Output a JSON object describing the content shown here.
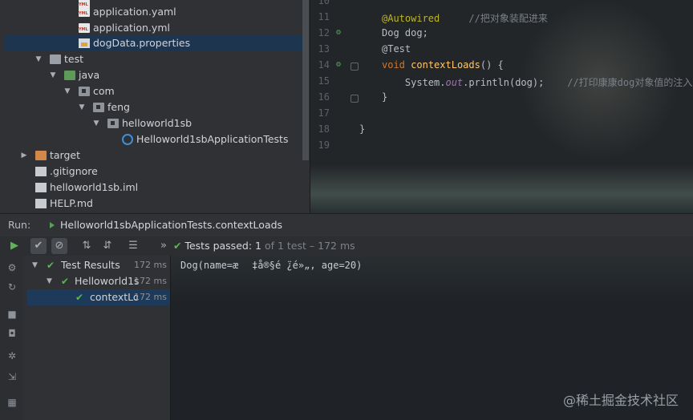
{
  "project_tree": {
    "items": [
      {
        "label": "application.yaml",
        "icon": "yaml-file-icon",
        "depth": 5,
        "arrow": ""
      },
      {
        "label": "application.yml",
        "icon": "yaml-file-icon",
        "depth": 5,
        "arrow": ""
      },
      {
        "label": "dogData.properties",
        "icon": "properties-file-icon",
        "depth": 5,
        "arrow": "",
        "selected": true
      },
      {
        "label": "test",
        "icon": "folder-icon",
        "depth": 2,
        "arrow": "▼"
      },
      {
        "label": "java",
        "icon": "source-folder-icon",
        "depth": 3,
        "arrow": "▼"
      },
      {
        "label": "com",
        "icon": "package-icon",
        "depth": 4,
        "arrow": "▼"
      },
      {
        "label": "feng",
        "icon": "package-icon",
        "depth": 5,
        "arrow": "▼"
      },
      {
        "label": "helloworld1sb",
        "icon": "package-icon",
        "depth": 6,
        "arrow": "▼"
      },
      {
        "label": "Helloworld1sbApplicationTests",
        "icon": "class-icon",
        "depth": 7,
        "arrow": ""
      },
      {
        "label": "target",
        "icon": "target-folder-icon",
        "depth": 1,
        "arrow": "▶"
      },
      {
        "label": ".gitignore",
        "icon": "gitignore-file-icon",
        "depth": 1,
        "arrow": ""
      },
      {
        "label": "helloworld1sb.iml",
        "icon": "iml-file-icon",
        "depth": 1,
        "arrow": ""
      },
      {
        "label": "HELP.md",
        "icon": "markdown-file-icon",
        "depth": 1,
        "arrow": ""
      }
    ]
  },
  "editor": {
    "lines": [
      {
        "num": "10",
        "code": ""
      },
      {
        "num": "11",
        "code": "@Autowired     //把对象装配进来"
      },
      {
        "num": "12",
        "code": "Dog dog;"
      },
      {
        "num": "13",
        "code": "@Test"
      },
      {
        "num": "14",
        "code": "void contextLoads() {"
      },
      {
        "num": "15",
        "code": "    System.out.println(dog);    //打印康康dog对象值的注入"
      },
      {
        "num": "16",
        "code": "}"
      },
      {
        "num": "17",
        "code": ""
      },
      {
        "num": "18",
        "code": "}"
      },
      {
        "num": "19",
        "code": ""
      }
    ]
  },
  "run_bar": {
    "label": "Run:",
    "tab_title": "Helloworld1sbApplicationTests.contextLoads"
  },
  "run_toolbar": {
    "check_mark": "✔",
    "passed_label": "Tests passed:",
    "passed_count": "1",
    "of_total": "of 1 test",
    "separator": "–",
    "duration": "172 ms",
    "chevron": "»"
  },
  "test_results": {
    "rows": [
      {
        "label": "Test Results",
        "time": "172 ms"
      },
      {
        "label": "Helloworld1s",
        "time": "172 ms"
      },
      {
        "label": "contextLo:",
        "time": "172 ms",
        "selected": true
      }
    ]
  },
  "console": {
    "output": "Dog(name=æ ‡å®§é ̈¿é»„, age=20)",
    "watermark": "@稀土掘金技术社区"
  },
  "colors": {
    "accent_green": "#5fb35a",
    "selection_blue": "#1d3a5a"
  }
}
